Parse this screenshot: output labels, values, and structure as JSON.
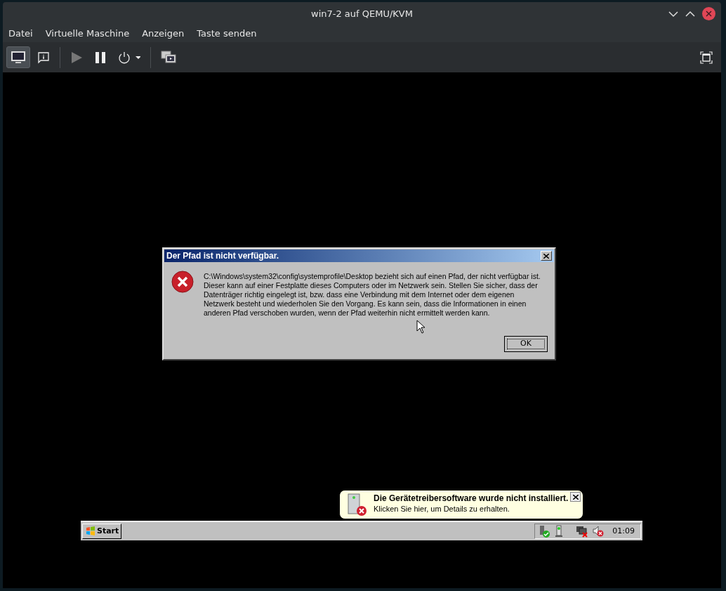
{
  "window": {
    "title": "win7-2 auf QEMU/KVM"
  },
  "menu": [
    "Datei",
    "Virtuelle Maschine",
    "Anzeigen",
    "Taste senden"
  ],
  "toolbar": [
    {
      "kind": "display",
      "selected": true
    },
    {
      "kind": "details",
      "selected": false
    },
    {
      "kind": "run",
      "selected": false
    },
    {
      "kind": "pause",
      "selected": false
    },
    {
      "kind": "power",
      "selected": false
    },
    {
      "kind": "snapshots",
      "selected": false
    }
  ],
  "dialog": {
    "title": "Der Pfad ist nicht verfügbar.",
    "message": "C:\\Windows\\system32\\config\\systemprofile\\Desktop bezieht sich auf einen Pfad, der nicht verfügbar ist. Dieser kann auf einer Festplatte dieses Computers oder im Netzwerk sein. Stellen Sie sicher, dass der Datenträger richtig eingelegt ist, bzw. dass eine Verbindung mit dem Internet oder dem eigenen Netzwerk besteht und wiederholen Sie den Vorgang. Es kann sein, dass die Informationen in einen anderen Pfad verschoben wurden, wenn der Pfad weiterhin nicht ermittelt werden kann.",
    "button": "OK"
  },
  "balloon": {
    "title": "Die Gerätetreibersoftware wurde nicht installiert.",
    "text": "Klicken Sie hier, um Details zu erhalten."
  },
  "taskbar": {
    "start": "Start",
    "clock": "01:09"
  }
}
